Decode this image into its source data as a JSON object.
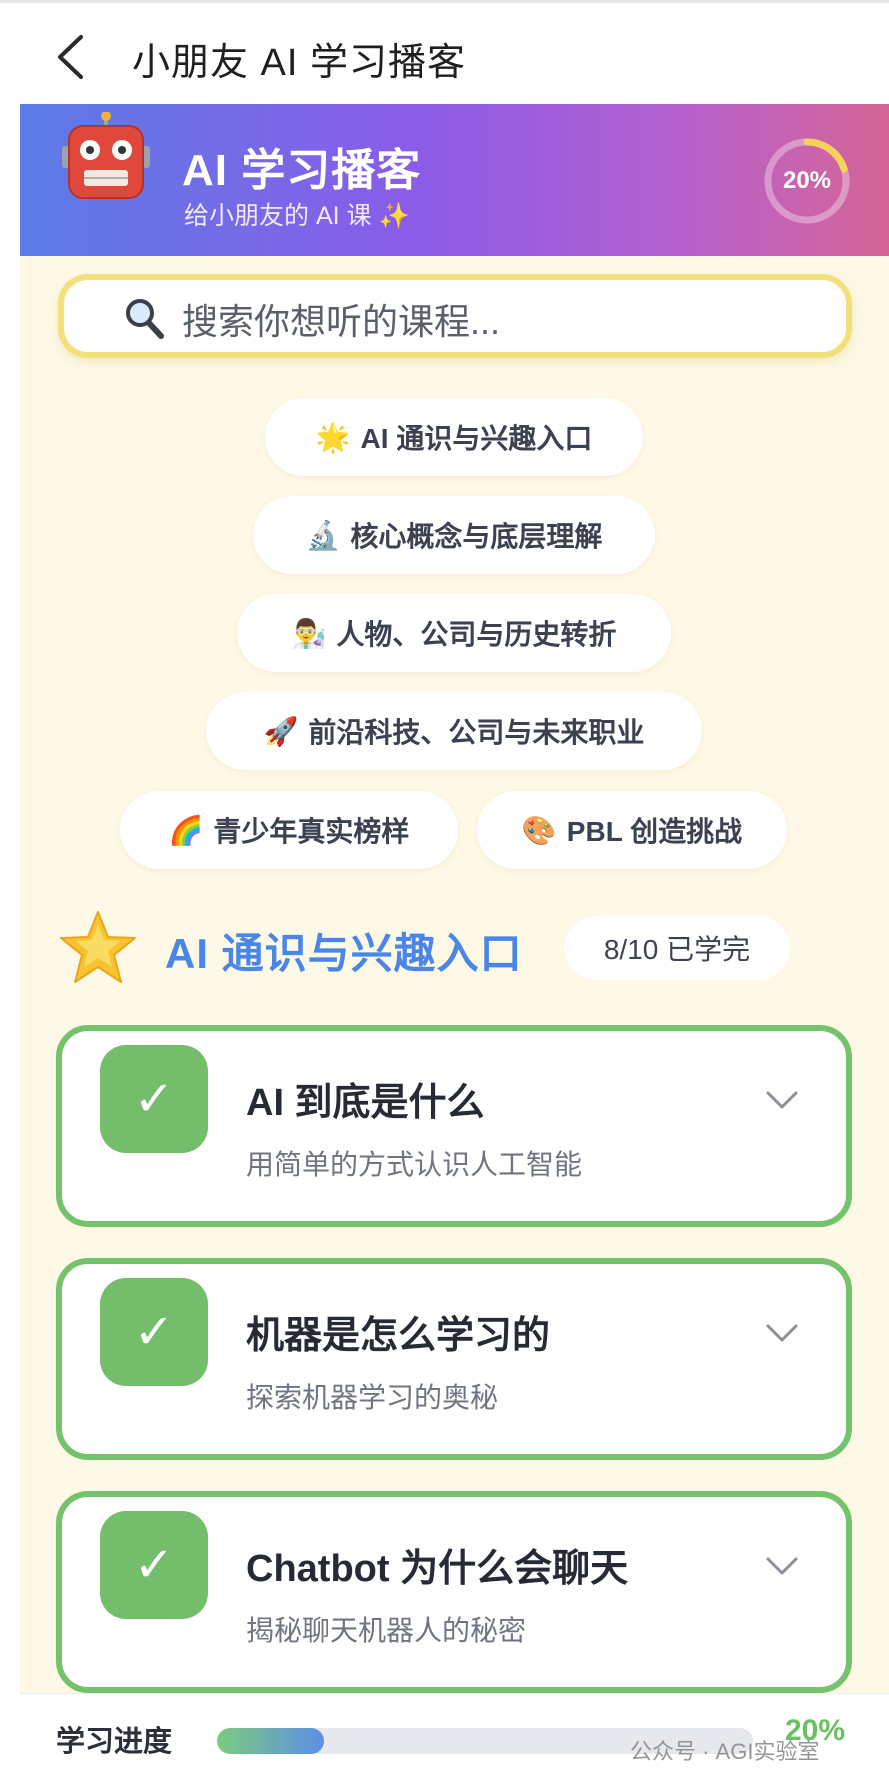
{
  "nav": {
    "title": "小朋友 AI 学习播客"
  },
  "hero": {
    "title": "AI 学习播客",
    "subtitle": "给小朋友的 AI 课",
    "sparkle": "✨",
    "progress_text": "20%",
    "progress": 0.2
  },
  "search": {
    "placeholder": "搜索你想听的课程..."
  },
  "categories": [
    {
      "icon": "🌟",
      "label": "AI 通识与兴趣入口"
    },
    {
      "icon": "🔬",
      "label": "核心概念与底层理解"
    },
    {
      "icon": "👨‍🔬",
      "label": "人物、公司与历史转折"
    },
    {
      "icon": "🚀",
      "label": "前沿科技、公司与未来职业"
    },
    {
      "icon": "🌈",
      "label": "青少年真实榜样"
    },
    {
      "icon": "🎨",
      "label": "PBL 创造挑战"
    }
  ],
  "section": {
    "icon": "🌟",
    "title": "AI 通识与兴趣入口",
    "badge": "8/10 已学完"
  },
  "lessons": [
    {
      "check": "✓",
      "title": "AI 到底是什么",
      "subtitle": "用简单的方式认识人工智能"
    },
    {
      "check": "✓",
      "title": "机器是怎么学习的",
      "subtitle": "探索机器学习的奥秘"
    },
    {
      "check": "✓",
      "title": "Chatbot 为什么会聊天",
      "subtitle": "揭秘聊天机器人的秘密"
    }
  ],
  "footer": {
    "label": "学习进度",
    "percent_text": "20%",
    "progress": 0.2,
    "watermark": "公众号 · AGI实验室"
  },
  "colors": {
    "accent_green": "#74c36c",
    "accent_blue": "#4a86e8",
    "search_border": "#f4df7d",
    "hero_start": "#5b7ce6",
    "hero_end": "#d66597"
  }
}
